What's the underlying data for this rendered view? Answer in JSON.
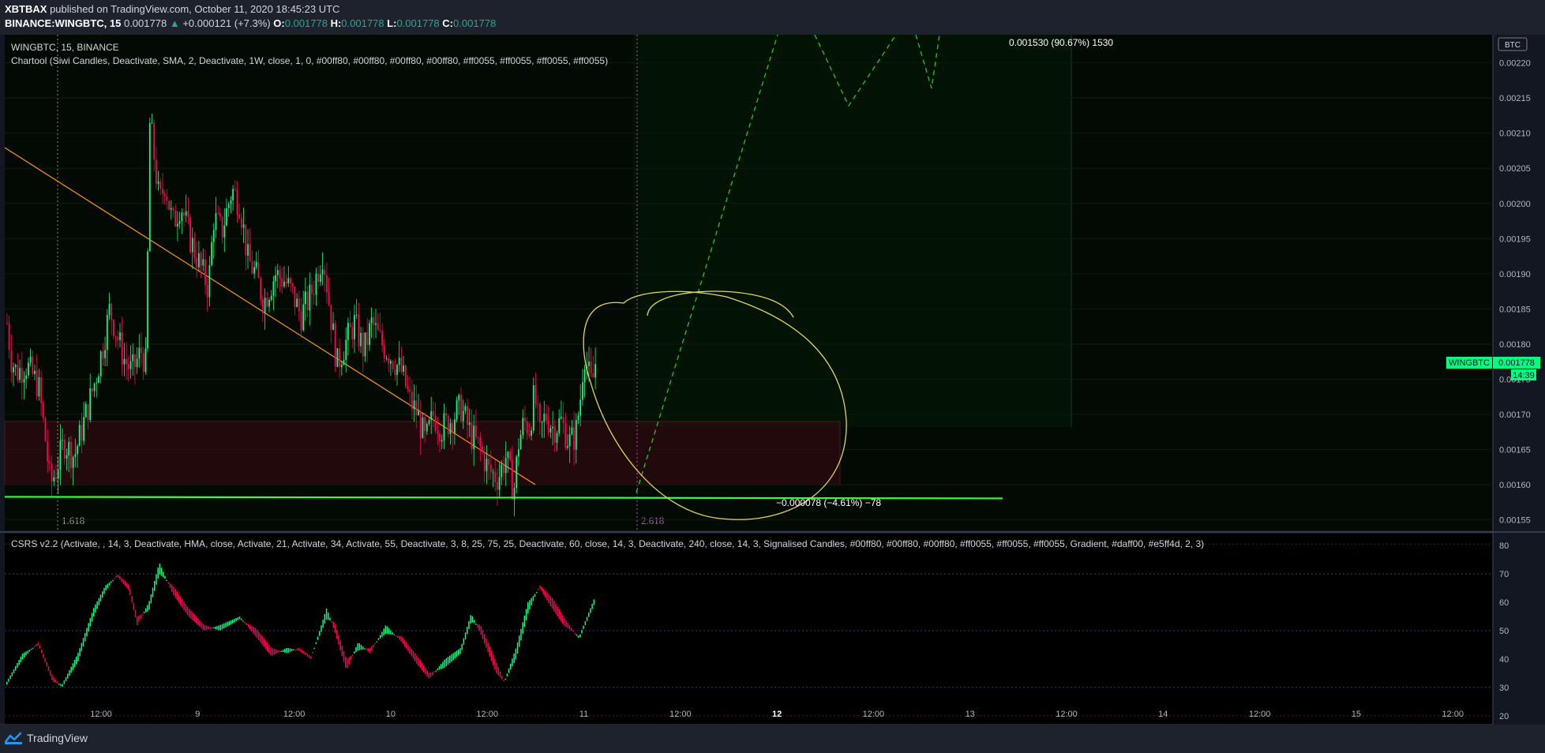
{
  "header": {
    "author": "XBTBAX",
    "published_text": "published on TradingView.com, October 11, 2020 18:45:23 UTC",
    "symbol": "BINANCE:WINGBTC, 15",
    "last": "0.001778",
    "change": "+0.000121 (+7.3%)",
    "o_label": "O:",
    "o": "0.001778",
    "h_label": "H:",
    "h": "0.001778",
    "l_label": "L:",
    "l": "0.001778",
    "c_label": "C:",
    "c": "0.001778"
  },
  "legends": {
    "main_title": "WINGBTC, 15, BINANCE",
    "chartool": "Chartool (Siwi Candles, Deactivate, SMA, 2, Deactivate, 1W, close, 1, 0, #00ff80, #00ff80, #00ff80, #00ff80, #ff0055, #ff0055, #ff0055, #ff0055)",
    "csrs": "CSRS v2.2 (Activate, , 14, 3, Deactivate, HMA, close, Activate, 21, Activate, 34, Activate, 55, Deactivate, 3, 8, 25, 75, 25, Deactivate, 60, close, 14, 3, Deactivate, 240, close, 14, 3, Signalised Candles, #00ff80, #00ff80, #00ff80, #ff0055, #ff0055, #ff0055, Gradient, #daff00, #e5ff4d, 2, 3)"
  },
  "annotations": {
    "measure_top": "0.001530 (90.67%) 1530",
    "measure_bottom": "−0.000078 (−4.61%) −78",
    "fib_left": "1.618",
    "fib_right": "2.618",
    "currency_badge": "BTC",
    "price_tag_label": "WINGBTC",
    "price_tag_value": "0.001778",
    "countdown": "14:39"
  },
  "colors": {
    "bull": "#00ff80",
    "bear": "#ff0055",
    "trendline": "#ff9800",
    "circle": "#e5d94a",
    "support": "#33ff33",
    "projection": "#22cc22"
  },
  "footer": {
    "brand": "TradingView"
  },
  "chart_data": [
    {
      "type": "candlestick",
      "title": "WINGBTC, 15, BINANCE",
      "x_ticks": [
        "12:00",
        "9",
        "12:00",
        "10",
        "12:00",
        "11",
        "12:00",
        "12",
        "12:00",
        "13",
        "12:00",
        "14",
        "12:00",
        "15",
        "12:00"
      ],
      "y_ticks": [
        "0.00220",
        "0.00215",
        "0.00210",
        "0.00205",
        "0.00200",
        "0.00195",
        "0.00190",
        "0.00185",
        "0.00180",
        "0.00175",
        "0.00170",
        "0.00165",
        "0.00160",
        "0.00155"
      ],
      "ylim": [
        0.001535,
        0.00224
      ],
      "close_series": [
        [
          0,
          0.00183
        ],
        [
          5,
          0.00178
        ],
        [
          12,
          0.00176
        ],
        [
          25,
          0.00177
        ],
        [
          40,
          0.00174
        ],
        [
          48,
          0.00167
        ],
        [
          55,
          0.0016
        ],
        [
          62,
          0.00162
        ],
        [
          72,
          0.00166
        ],
        [
          85,
          0.00164
        ],
        [
          100,
          0.0017
        ],
        [
          112,
          0.00175
        ],
        [
          122,
          0.0018
        ],
        [
          130,
          0.00185
        ],
        [
          140,
          0.00181
        ],
        [
          148,
          0.00178
        ],
        [
          158,
          0.00176
        ],
        [
          170,
          0.00179
        ],
        [
          176,
          0.00177
        ],
        [
          181,
          0.00212
        ],
        [
          186,
          0.00207
        ],
        [
          193,
          0.002
        ],
        [
          200,
          0.00203
        ],
        [
          210,
          0.00197
        ],
        [
          220,
          0.002
        ],
        [
          232,
          0.00195
        ],
        [
          245,
          0.00191
        ],
        [
          255,
          0.00188
        ],
        [
          262,
          0.00198
        ],
        [
          272,
          0.00196
        ],
        [
          285,
          0.00202
        ],
        [
          295,
          0.002
        ],
        [
          305,
          0.00192
        ],
        [
          315,
          0.0019
        ],
        [
          325,
          0.00186
        ],
        [
          340,
          0.0019
        ],
        [
          352,
          0.00189
        ],
        [
          362,
          0.00187
        ],
        [
          372,
          0.00184
        ],
        [
          385,
          0.00187
        ],
        [
          400,
          0.00193
        ],
        [
          410,
          0.00184
        ],
        [
          418,
          0.00177
        ],
        [
          428,
          0.0018
        ],
        [
          440,
          0.00183
        ],
        [
          452,
          0.00179
        ],
        [
          462,
          0.00183
        ],
        [
          475,
          0.0018
        ],
        [
          488,
          0.00178
        ],
        [
          500,
          0.00176
        ],
        [
          510,
          0.00172
        ],
        [
          520,
          0.0017
        ],
        [
          530,
          0.00166
        ],
        [
          540,
          0.0017
        ],
        [
          550,
          0.00168
        ],
        [
          560,
          0.00169
        ],
        [
          575,
          0.00171
        ],
        [
          588,
          0.00167
        ],
        [
          600,
          0.00165
        ],
        [
          610,
          0.00162
        ],
        [
          622,
          0.00161
        ],
        [
          632,
          0.00164
        ],
        [
          642,
          0.00159
        ],
        [
          648,
          0.00166
        ],
        [
          655,
          0.00169
        ],
        [
          662,
          0.00168
        ],
        [
          668,
          0.00173
        ],
        [
          675,
          0.00167
        ],
        [
          682,
          0.0017
        ],
        [
          692,
          0.00168
        ],
        [
          702,
          0.00169
        ],
        [
          712,
          0.00166
        ],
        [
          720,
          0.00167
        ],
        [
          726,
          0.00172
        ],
        [
          731,
          0.00179
        ],
        [
          736,
          0.00176
        ],
        [
          741,
          0.00174
        ],
        [
          746,
          0.00178
        ]
      ],
      "levels": {
        "support": 0.001585,
        "zone_top": 0.00169,
        "zone_bottom": 0.0016
      }
    },
    {
      "type": "line",
      "title": "CSRS v2.2",
      "y_ticks": [
        "80",
        "70",
        "60",
        "50",
        "40",
        "30",
        "20"
      ],
      "ylim": [
        18,
        82
      ],
      "hlines": [
        70,
        50,
        30
      ],
      "series": [
        {
          "fast": [
            [
              0,
              32
            ],
            [
              20,
              42
            ],
            [
              40,
              45
            ],
            [
              58,
              32
            ],
            [
              70,
              31
            ],
            [
              90,
              42
            ],
            [
              110,
              58
            ],
            [
              125,
              66
            ],
            [
              140,
              69
            ],
            [
              155,
              64
            ],
            [
              165,
              52
            ],
            [
              180,
              60
            ],
            [
              193,
              74
            ],
            [
              210,
              63
            ],
            [
              230,
              55
            ],
            [
              250,
              50
            ],
            [
              270,
              52
            ],
            [
              295,
              55
            ],
            [
              315,
              48
            ],
            [
              335,
              41
            ],
            [
              355,
              44
            ],
            [
              370,
              43
            ],
            [
              385,
              40
            ],
            [
              405,
              58
            ],
            [
              415,
              50
            ],
            [
              430,
              36
            ],
            [
              445,
              46
            ],
            [
              460,
              42
            ],
            [
              480,
              52
            ],
            [
              500,
              46
            ],
            [
              520,
              38
            ],
            [
              535,
              33
            ],
            [
              555,
              40
            ],
            [
              575,
              44
            ],
            [
              588,
              56
            ],
            [
              600,
              49
            ],
            [
              620,
              35
            ],
            [
              630,
              32
            ],
            [
              645,
              44
            ],
            [
              660,
              60
            ],
            [
              675,
              65
            ],
            [
              690,
              58
            ],
            [
              705,
              52
            ],
            [
              725,
              48
            ],
            [
              745,
              62
            ]
          ]
        },
        {
          "slow": [
            [
              0,
              31
            ],
            [
              20,
              40
            ],
            [
              40,
              46
            ],
            [
              58,
              34
            ],
            [
              70,
              30
            ],
            [
              90,
              39
            ],
            [
              110,
              55
            ],
            [
              125,
              64
            ],
            [
              140,
              70
            ],
            [
              155,
              66
            ],
            [
              165,
              55
            ],
            [
              180,
              57
            ],
            [
              193,
              70
            ],
            [
              210,
              66
            ],
            [
              230,
              58
            ],
            [
              250,
              52
            ],
            [
              270,
              50
            ],
            [
              295,
              54
            ],
            [
              315,
              51
            ],
            [
              335,
              44
            ],
            [
              355,
              42
            ],
            [
              370,
              44
            ],
            [
              385,
              41
            ],
            [
              405,
              54
            ],
            [
              415,
              53
            ],
            [
              430,
              40
            ],
            [
              445,
              43
            ],
            [
              460,
              44
            ],
            [
              480,
              49
            ],
            [
              500,
              48
            ],
            [
              520,
              41
            ],
            [
              535,
              35
            ],
            [
              555,
              37
            ],
            [
              575,
              42
            ],
            [
              588,
              53
            ],
            [
              600,
              52
            ],
            [
              620,
              39
            ],
            [
              630,
              32
            ],
            [
              645,
              40
            ],
            [
              660,
              56
            ],
            [
              675,
              66
            ],
            [
              690,
              62
            ],
            [
              705,
              55
            ],
            [
              725,
              47
            ],
            [
              745,
              60
            ]
          ]
        }
      ]
    }
  ]
}
